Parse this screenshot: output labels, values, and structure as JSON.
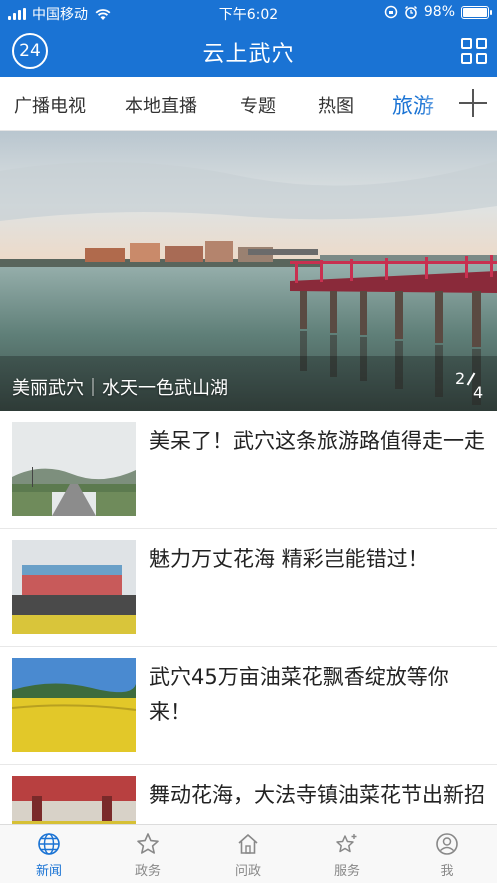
{
  "status_bar": {
    "carrier": "中国移动",
    "time": "下午6:02",
    "battery": "98%",
    "battery_level": 0.98
  },
  "header": {
    "logo_text": "24",
    "title": "云上武穴",
    "menu_icon": "grid-icon"
  },
  "tabs": [
    {
      "label": "广播电视"
    },
    {
      "label": "本地直播"
    },
    {
      "label": "专题"
    },
    {
      "label": "热图"
    },
    {
      "label": "旅游"
    }
  ],
  "add_channel_icon": "plus-icon",
  "banner": {
    "caption": "美丽武穴｜水天一色武山湖",
    "current_page": "2",
    "total_pages": "4"
  },
  "news": [
    {
      "title": "美呆了！武穴这条旅游路值得走一走"
    },
    {
      "title": "魅力万丈花海 精彩岂能错过！"
    },
    {
      "title": "武穴45万亩油菜花飘香绽放等你来！"
    },
    {
      "title": "舞动花海，大法寺镇油菜花节出新招"
    }
  ],
  "bottom_nav": [
    {
      "label": "新闻",
      "icon": "globe-icon",
      "active": true
    },
    {
      "label": "政务",
      "icon": "star-icon",
      "active": false
    },
    {
      "label": "问政",
      "icon": "home-icon",
      "active": false
    },
    {
      "label": "服务",
      "icon": "sparkle-star-icon",
      "active": false
    },
    {
      "label": "我",
      "icon": "user-icon",
      "active": false
    }
  ],
  "colors": {
    "brand_blue": "#1a73d4",
    "active_tab": "#1a73d4",
    "inactive_nav": "#888888"
  }
}
